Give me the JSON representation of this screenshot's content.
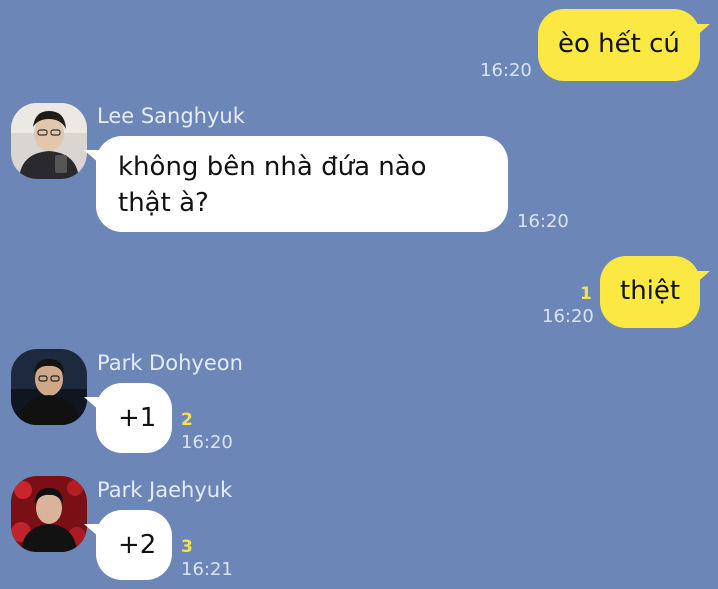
{
  "messages": [
    {
      "side": "out",
      "text": "èo hết cú",
      "time": "16:20",
      "unread": ""
    },
    {
      "side": "in",
      "sender": "Lee Sanghyuk",
      "avatar": "avatar-lee-sanghyuk",
      "text_line1": "không bên nhà đứa nào",
      "text_line2": "thật à?",
      "time": "16:20",
      "unread": ""
    },
    {
      "side": "out",
      "text": "thiệt",
      "time": "16:20",
      "unread": "1"
    },
    {
      "side": "in",
      "sender": "Park Dohyeon",
      "avatar": "avatar-park-dohyeon",
      "text": "+1",
      "time": "16:20",
      "unread": "2"
    },
    {
      "side": "in",
      "sender": "Park Jaehyuk",
      "avatar": "avatar-park-jaehyuk",
      "text": "+2",
      "time": "16:21",
      "unread": "3"
    }
  ],
  "colors": {
    "background": "#6b86b7",
    "outgoing_bubble": "#fbe843",
    "incoming_bubble": "#ffffff",
    "unread_count": "#f8e14a"
  }
}
